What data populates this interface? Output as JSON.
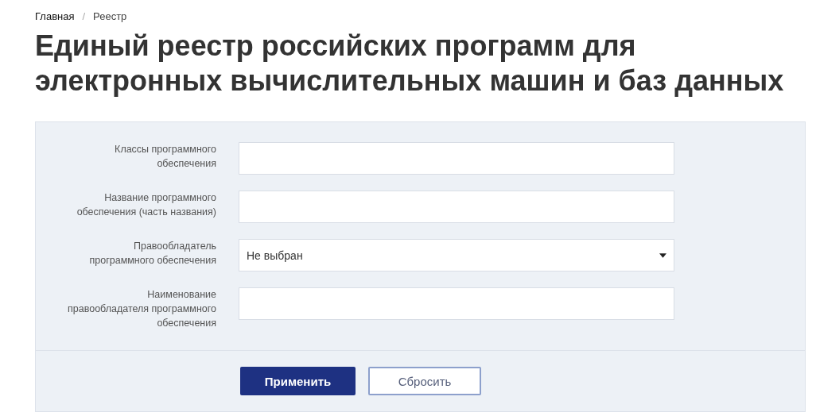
{
  "breadcrumbs": [
    {
      "label": "Главная",
      "kind": "link"
    },
    {
      "label": "Реестр",
      "kind": "current"
    }
  ],
  "breadcrumb_separator": "/",
  "title": "Единый реестр российских программ для электронных вычислительных машин и баз данных",
  "filter_form": {
    "fields": [
      {
        "kind": "text",
        "label_lines": [
          "Классы программного",
          "обеспечения"
        ]
      },
      {
        "kind": "text",
        "label_lines": [
          "Название программного",
          "обеспечения (часть названия)"
        ]
      },
      {
        "kind": "select",
        "label_lines": [
          "Правообладатель",
          "программного обеспечения"
        ],
        "value": "Не выбран"
      },
      {
        "kind": "text",
        "label_lines": [
          "Наименование",
          "правообладателя программного",
          "обеспечения"
        ]
      }
    ],
    "buttons": [
      {
        "label": "Применить",
        "kind": "primary"
      },
      {
        "label": "Сбросить",
        "kind": "secondary"
      }
    ]
  }
}
